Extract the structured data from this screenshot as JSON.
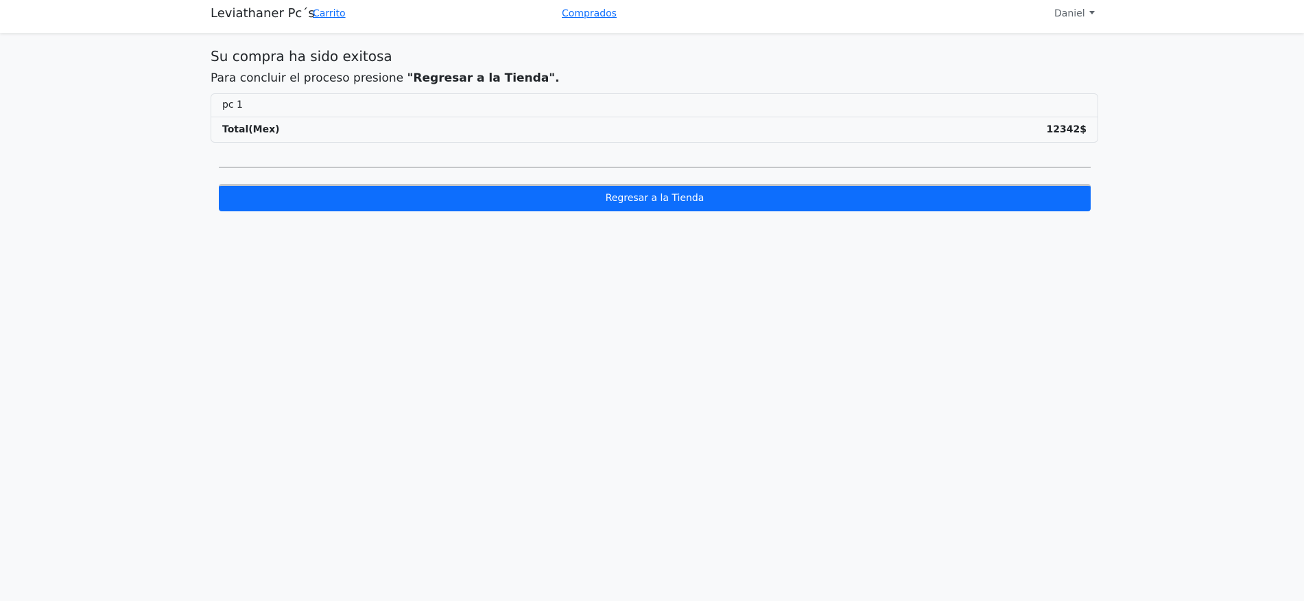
{
  "navbar": {
    "brand": "Leviathaner Pc´s",
    "links": {
      "carrito": "Carrito",
      "comprados": "Comprados"
    },
    "user": "Daniel"
  },
  "main": {
    "title": "Su compra ha sido exitosa",
    "subtitle_prefix": "Para concluir el proceso presione ",
    "subtitle_emphasis": "\"Regresar a la Tienda\".",
    "items": [
      {
        "name": "pc 1"
      }
    ],
    "total": {
      "label": "Total(Mex)",
      "value": "12342$"
    },
    "return_button": "Regresar a la Tienda"
  },
  "colors": {
    "primary": "#0d6efd",
    "background": "#f8f9fa",
    "navbar_bg": "#ffffff",
    "text": "#212529"
  },
  "icons": {
    "user_dropdown": "chevron-down-icon"
  }
}
